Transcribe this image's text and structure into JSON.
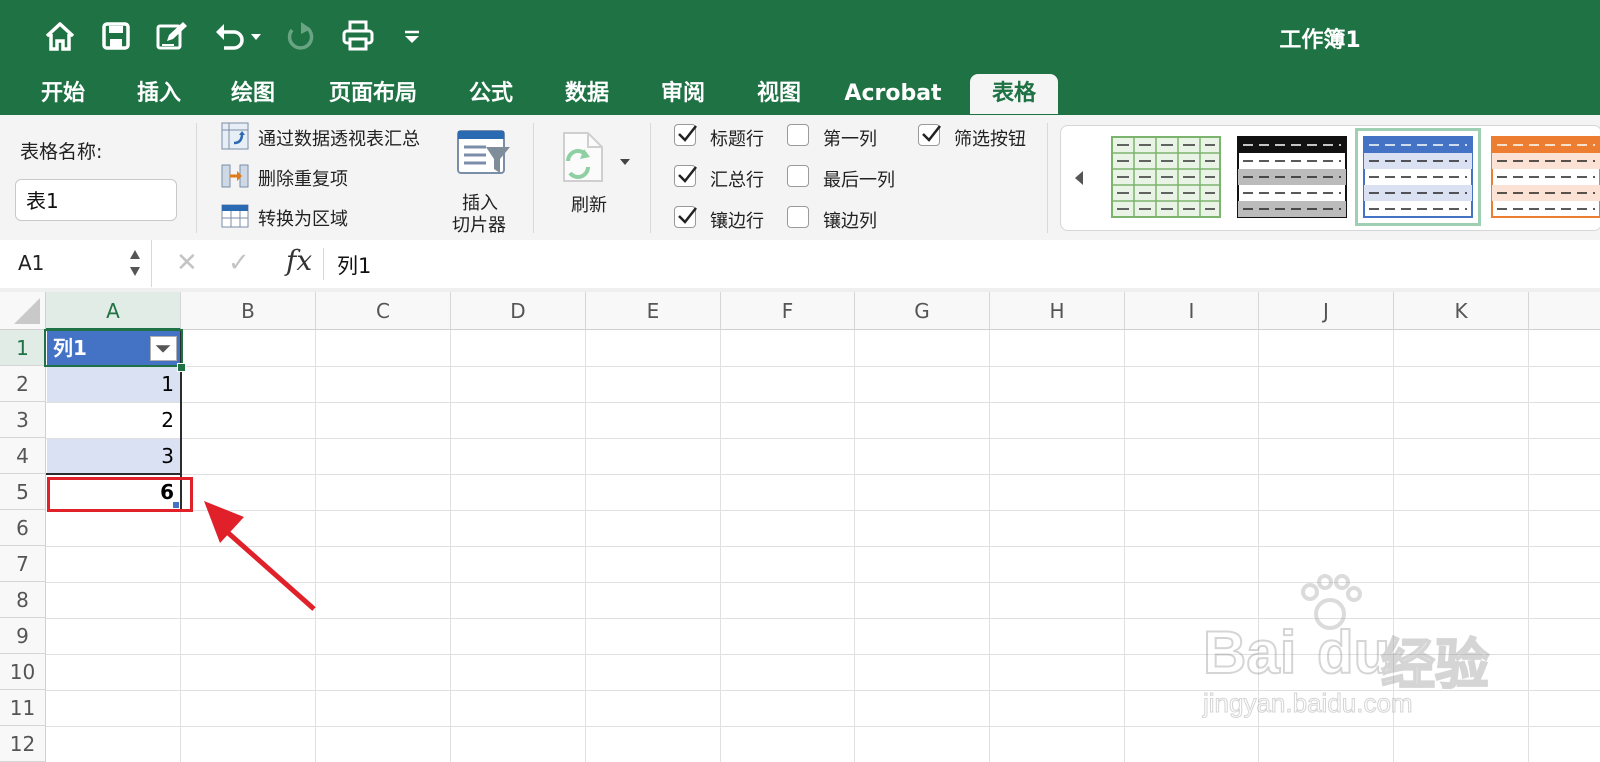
{
  "app": {
    "title": "工作簿1",
    "accent_color": "#1f7244",
    "quick_access": [
      "home-icon",
      "save-icon",
      "edit-icon",
      "undo-icon",
      "redo-icon",
      "print-icon",
      "customize-icon"
    ]
  },
  "tabs": [
    {
      "label": "开始"
    },
    {
      "label": "插入"
    },
    {
      "label": "绘图"
    },
    {
      "label": "页面布局"
    },
    {
      "label": "公式"
    },
    {
      "label": "数据"
    },
    {
      "label": "审阅"
    },
    {
      "label": "视图"
    },
    {
      "label": "Acrobat"
    },
    {
      "label": "表格",
      "active": true
    }
  ],
  "ribbon": {
    "table_name_label": "表格名称:",
    "table_name_value": "表1",
    "tools": {
      "pivot": "通过数据透视表汇总",
      "remove_duplicates": "删除重复项",
      "convert_range": "转换为区域"
    },
    "slicer_line1": "插入",
    "slicer_line2": "切片器",
    "refresh": "刷新",
    "options": [
      {
        "label": "标题行",
        "checked": true
      },
      {
        "label": "第一列",
        "checked": false
      },
      {
        "label": "筛选按钮",
        "checked": true
      },
      {
        "label": "汇总行",
        "checked": true
      },
      {
        "label": "最后一列",
        "checked": false
      },
      {
        "label": "镶边行",
        "checked": true
      },
      {
        "label": "镶边列",
        "checked": false
      }
    ]
  },
  "formula_bar": {
    "name_box": "A1",
    "cancel": "✕",
    "confirm": "✓",
    "fx": "fx",
    "value": "列1"
  },
  "grid": {
    "columns": [
      "A",
      "B",
      "C",
      "D",
      "E",
      "F",
      "G",
      "H",
      "I",
      "J",
      "K"
    ],
    "rows": [
      "1",
      "2",
      "3",
      "4",
      "5",
      "6",
      "7",
      "8",
      "9",
      "10",
      "11",
      "12"
    ],
    "header_cell": "列1",
    "values": [
      "1",
      "2",
      "3"
    ],
    "total": "6",
    "header_color": "#4472c4",
    "band_color": "#d9e1f2",
    "highlight_color": "#e0212a"
  },
  "watermark": {
    "brand": "Bai",
    "suffix": "du",
    "cn": "经验",
    "url": "jingyan.baidu.com"
  }
}
